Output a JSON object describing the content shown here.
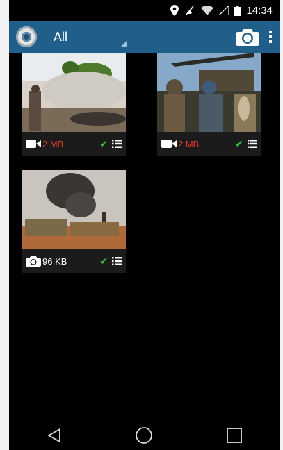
{
  "status_bar": {
    "time": "14:34",
    "icons": [
      "location-icon",
      "mute-icon",
      "wifi-icon",
      "signal-icon",
      "battery-icon"
    ]
  },
  "app_bar": {
    "title": "All",
    "logo_icon": "app-logo-icon",
    "camera_icon": "camera-icon",
    "overflow_icon": "overflow-menu-icon"
  },
  "media_items": [
    {
      "type": "video",
      "size": "2 MB",
      "size_color": "#e03a2a",
      "status_icon": "check-icon",
      "menu_icon": "list-icon"
    },
    {
      "type": "video",
      "size": "2 MB",
      "size_color": "#e03a2a",
      "status_icon": "check-icon",
      "menu_icon": "list-icon"
    },
    {
      "type": "photo",
      "size": "96 KB",
      "size_color": "#ffffff",
      "status_icon": "check-icon",
      "menu_icon": "list-icon"
    }
  ],
  "nav_bar": {
    "back_icon": "back-icon",
    "home_icon": "home-icon",
    "recents_icon": "recents-icon"
  },
  "colors": {
    "app_bar": "#1f5f8a",
    "background": "#000000",
    "check": "#3ec43e",
    "alert_size": "#e03a2a"
  }
}
